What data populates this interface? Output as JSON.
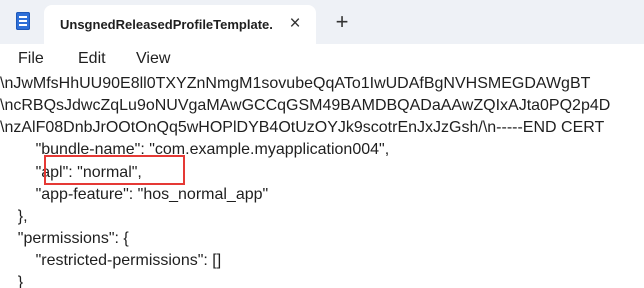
{
  "window": {
    "app_icon": "notepad-icon",
    "tab_title": "UnsgnedReleasedProfileTemplate.",
    "tab_close_icon": "×",
    "new_tab_icon": "+"
  },
  "menu": {
    "items": [
      "File",
      "Edit",
      "View"
    ]
  },
  "editor": {
    "lines": [
      "\\nJwMfsHhUU90E8ll0TXYZnNmgM1sovubeQqATo1IwUDAfBgNVHSMEGDAWgBT",
      "\\ncRBQsJdwcZqLu9oNUVgaMAwGCCqGSM49BAMDBQADaAAwZQIxAJta0PQ2p4D",
      "\\nzAlF08DnbJrOOtOnQq5wHOPlDYB4OtUzOYJk9scotrEnJxJzGsh/\\n-----END CERT",
      "        \"bundle-name\": \"com.example.myapplication004\",",
      "        \"apl\": \"normal\",",
      "        \"app-feature\": \"hos_normal_app\"",
      "    },",
      "    \"permissions\": {",
      "        \"restricted-permissions\": []",
      "    }"
    ]
  },
  "annotation": {
    "highlight_color": "#e53935"
  }
}
